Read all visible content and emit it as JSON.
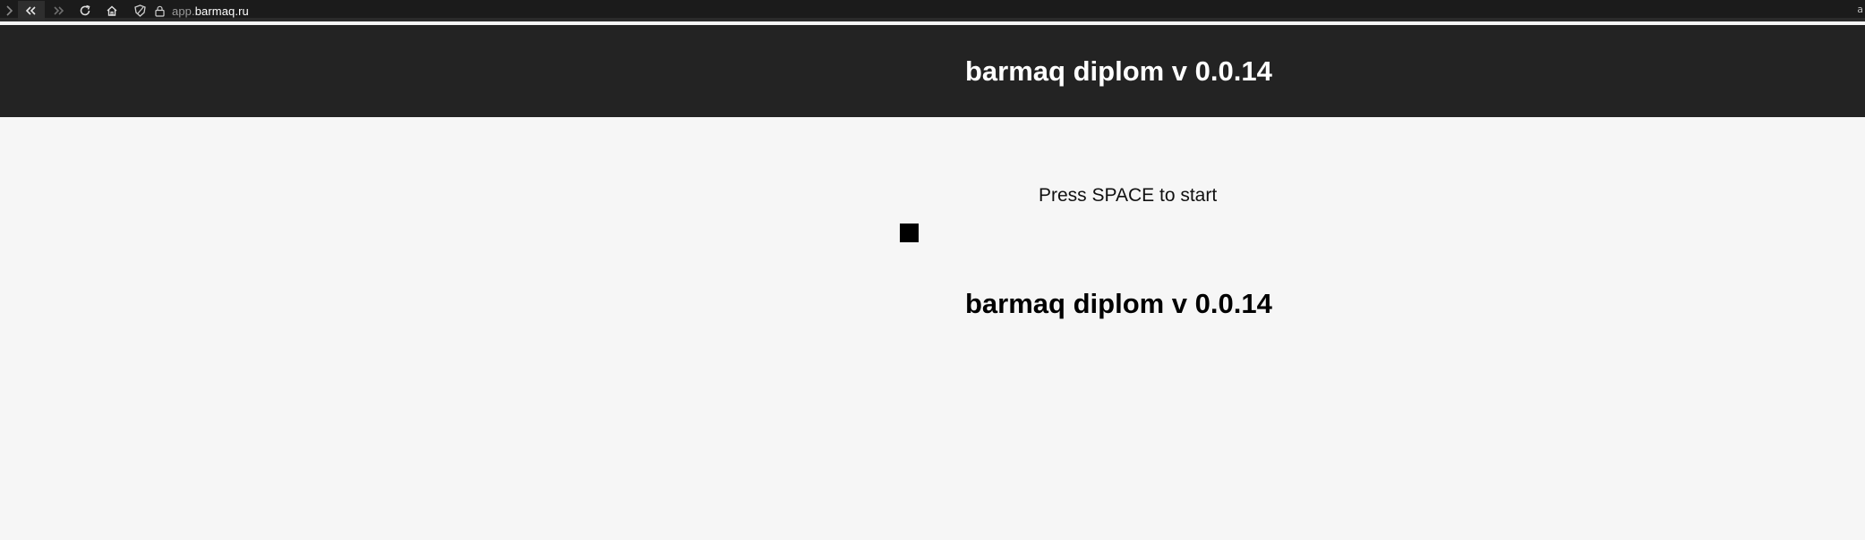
{
  "browser": {
    "url_prefix": "app.",
    "url_domain": "barmaq.ru",
    "icons": [
      "forward-icon",
      "back-double-icon",
      "forward-double-icon",
      "reload-icon",
      "home-icon",
      "tracking-shield-icon",
      "lock-icon"
    ],
    "right_edge_glyph": "a"
  },
  "header": {
    "title": "barmaq diplom v 0.0.14"
  },
  "game": {
    "prompt": "Press SPACE to start",
    "title": "barmaq diplom v 0.0.14"
  },
  "colors": {
    "header_bg": "#232323",
    "page_bg": "#f6f6f6",
    "player": "#000000"
  }
}
